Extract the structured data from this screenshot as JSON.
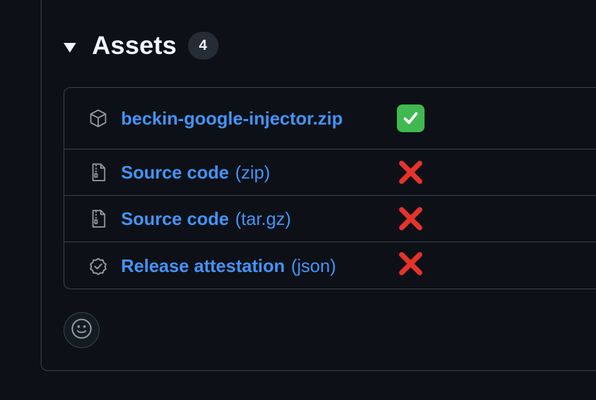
{
  "assets": {
    "title": "Assets",
    "count": "4",
    "items": [
      {
        "name": "beckin-google-injector.zip",
        "ext": "",
        "icon": "package-icon",
        "status": "check"
      },
      {
        "name": "Source code",
        "ext": "(zip)",
        "icon": "file-zip-icon",
        "status": "cross"
      },
      {
        "name": "Source code",
        "ext": "(tar.gz)",
        "icon": "file-zip-icon",
        "status": "cross"
      },
      {
        "name": "Release attestation",
        "ext": "(json)",
        "icon": "verified-icon",
        "status": "cross"
      }
    ]
  },
  "reaction": {
    "icon": "smiley-icon"
  },
  "colors": {
    "background": "#0d1117",
    "border": "#3d444d",
    "link": "#4493f8",
    "check_green": "#3fb950",
    "cross_red": "#e5332a"
  }
}
